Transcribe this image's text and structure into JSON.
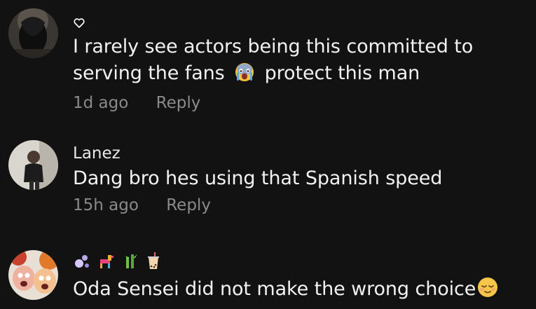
{
  "comments": [
    {
      "username": "",
      "username_icon": "heart-outline-icon",
      "text_before": "I rarely see actors being this committed to serving the fans",
      "emoji": "crying-face-emoji",
      "text_after": "protect this man",
      "time": "1d ago",
      "reply_label": "Reply"
    },
    {
      "username": "Lanez",
      "text": "Dang bro hes using that Spanish speed",
      "time": "15h ago",
      "reply_label": "Reply"
    },
    {
      "username_icons": [
        "bubbles-icon",
        "pinata-icon",
        "bamboo-icon",
        "bubble-tea-icon"
      ],
      "text": "Oda Sensei did not make the wrong choice",
      "emoji": "relieved-face-emoji"
    }
  ],
  "colors": {
    "background": "#121212",
    "text": "#f2f2f2",
    "muted": "#8a8a8a"
  }
}
